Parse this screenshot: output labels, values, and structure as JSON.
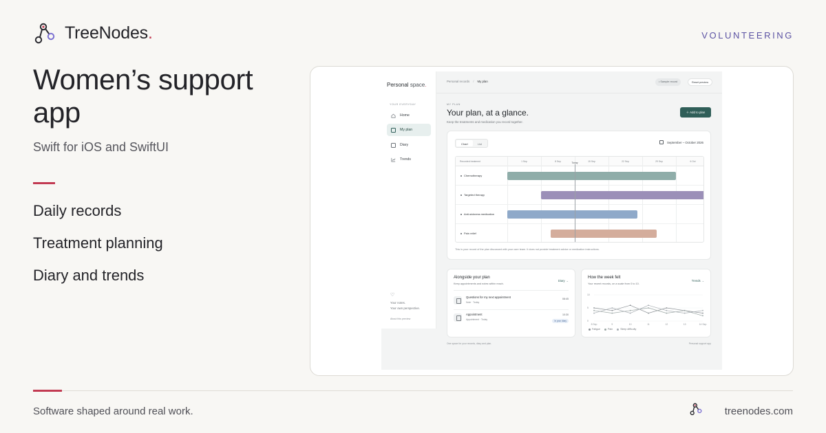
{
  "brand": {
    "name": "TreeNodes",
    "dot": "."
  },
  "category": "VOLUNTEERING",
  "hero": {
    "title": "Women’s support app",
    "subtitle": "Swift for iOS and SwiftUI",
    "features": [
      "Daily records",
      "Treatment planning",
      "Diary and trends"
    ]
  },
  "footer": {
    "tagline": "Software shaped around real work.",
    "domain": "treenodes.com"
  },
  "colors": {
    "accent": "#c23a52",
    "category": "#5b52a3",
    "app_primary": "#2f5e58"
  },
  "app": {
    "sidebar": {
      "brand_personal": "Personal",
      "brand_space": "space",
      "brand_dot": ".",
      "section": "YOUR EVERYDAY",
      "items": [
        {
          "label": "Home",
          "icon": "home-icon",
          "active": false
        },
        {
          "label": "My plan",
          "icon": "calendar-icon",
          "active": true
        },
        {
          "label": "Diary",
          "icon": "book-icon",
          "active": false
        },
        {
          "label": "Trends",
          "icon": "trend-icon",
          "active": false
        }
      ],
      "footer_line1": "Your notes.",
      "footer_line2": "Your own perspective.",
      "footer_link": "About this preview"
    },
    "topbar": {
      "crumb_parent": "Personal records",
      "crumb_sep": "/",
      "crumb_current": "My plan",
      "sample_label": "Sample record",
      "reset_label": "Reset preview"
    },
    "plan": {
      "eyebrow": "MY PLAN",
      "title": "Your plan, at a glance.",
      "subtitle": "Keep the treatments and medication you record together.",
      "add_button": "Add to plan"
    },
    "gantt": {
      "tabs": [
        "Chart",
        "List"
      ],
      "active_tab": "Chart",
      "range": "September – October 2026",
      "column_header": "Recorded treatment",
      "ticks": [
        "1 Sep",
        "8 Sep",
        "15 Sep",
        "22 Sep",
        "29 Sep",
        "6 Oct"
      ],
      "today_label": "Today",
      "note": "This is your record of the plan discussed with your care team. It does not provide treatment advice or medication instructions."
    },
    "alongside": {
      "title": "Alongside your plan",
      "subtitle": "Keep appointments and notes within reach.",
      "link": "Diary →",
      "items": [
        {
          "title": "Questions for my next appointment",
          "meta": "Note · Today",
          "time": "08:45",
          "badge": ""
        },
        {
          "title": "Appointment",
          "meta": "Appointment · Today",
          "time": "10:30",
          "badge": "In your diary"
        }
      ]
    },
    "week": {
      "title": "How the week felt",
      "subtitle": "Your recent records, on a scale from 0 to 10.",
      "link": "Trends →"
    },
    "footer_left": "One space for your records, diary and plan.",
    "footer_right": "Personal support app"
  },
  "chart_data": [
    {
      "type": "gantt",
      "title": "",
      "x_unit": "day of September 2026 (1 Sep = 1)",
      "xlim": [
        1,
        42
      ],
      "today": 15,
      "categories": [
        "Chemotherapy",
        "Targeted therapy",
        "Anti-sickness medication",
        "Pain relief"
      ],
      "series": [
        {
          "name": "Chemotherapy",
          "start": 1,
          "end": 36,
          "color": "#8fada9"
        },
        {
          "name": "Targeted therapy",
          "start": 8,
          "end": 42,
          "color": "#9b8fb8"
        },
        {
          "name": "Anti-sickness medication",
          "start": 1,
          "end": 28,
          "color": "#8fa9c9"
        },
        {
          "name": "Pain relief",
          "start": 10,
          "end": 32,
          "color": "#d4ad9c"
        }
      ]
    },
    {
      "type": "line",
      "title": "",
      "x": [
        "8 Sep",
        "9",
        "10",
        "11",
        "12",
        "13",
        "14 Sep"
      ],
      "ylim": [
        0,
        10
      ],
      "y_ticks": [
        "10",
        "5",
        "0"
      ],
      "grid": true,
      "legend_position": "bottom-left",
      "series": [
        {
          "name": "Fatigue",
          "color": "#8a8f94",
          "values": [
            5,
            4,
            6,
            3,
            5,
            4,
            3
          ]
        },
        {
          "name": "Pain",
          "color": "#9aa5a3",
          "values": [
            4,
            3,
            4,
            5,
            3,
            4,
            2
          ]
        },
        {
          "name": "Sleep difficulty",
          "color": "#a7adb2",
          "values": [
            3,
            5,
            3,
            6,
            4,
            3,
            4
          ]
        }
      ]
    }
  ]
}
